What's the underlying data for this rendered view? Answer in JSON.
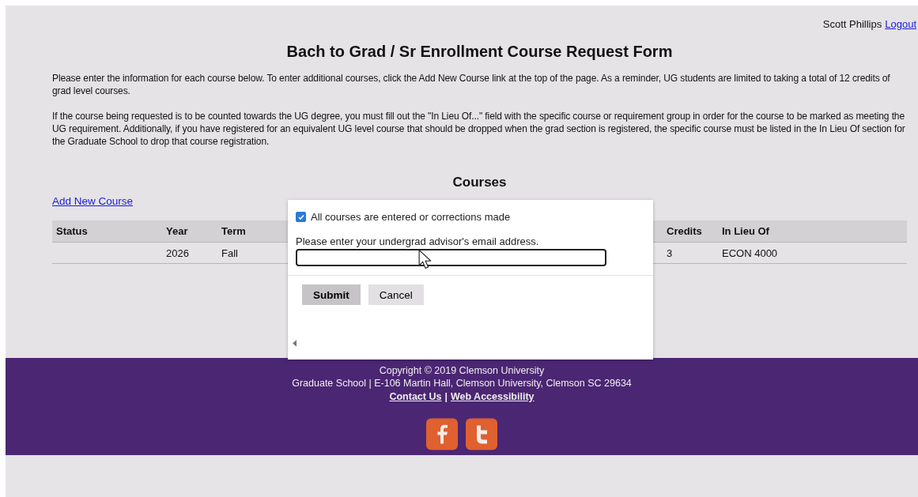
{
  "user": {
    "name": "Scott Phillips",
    "logout": "Logout"
  },
  "title": "Bach to Grad / Sr Enrollment Course Request Form",
  "paragraphs": [
    "Please enter the information for each course below. To enter additional courses, click the Add New Course link at the top of the page. As a reminder, UG students are limited to taking a total of 12 credits of grad level courses.",
    "If the course being requested is to be counted towards the UG degree, you must fill out the \"In Lieu Of...\" field with the specific course or requirement group in order for the course to be marked as meeting the UG requirement. Additionally, if you have registered for an equivalent UG level course that should be dropped when the grad section is registered, the specific course must be listed in the In Lieu Of section for the Graduate School to drop that course registration."
  ],
  "courses": {
    "heading": "Courses",
    "add_link": "Add New Course",
    "table": {
      "columns": [
        "Status",
        "Year",
        "Term",
        "Credits",
        "In Lieu Of"
      ],
      "rows": [
        [
          "",
          "2026",
          "Fall",
          "3",
          "ECON 4000"
        ]
      ]
    }
  },
  "dialog": {
    "checkbox": {
      "label": "All courses are entered or corrections made",
      "checked": true
    },
    "email_label": "Please enter your undergrad advisor's email address.",
    "buttons": [
      {
        "label": "Submit",
        "kind": "primary"
      },
      {
        "label": "Cancel",
        "kind": "secondary"
      }
    ]
  },
  "footer": {
    "copyright": "Copyright © 2019 Clemson University",
    "address": "Graduate School | E-106 Martin Hall, Clemson University, Clemson SC 29634",
    "links": [
      "Contact Us",
      "Web Accessibility"
    ],
    "separator": "|",
    "social": [
      {
        "kind": "facebook"
      },
      {
        "kind": "twitter"
      }
    ]
  }
}
